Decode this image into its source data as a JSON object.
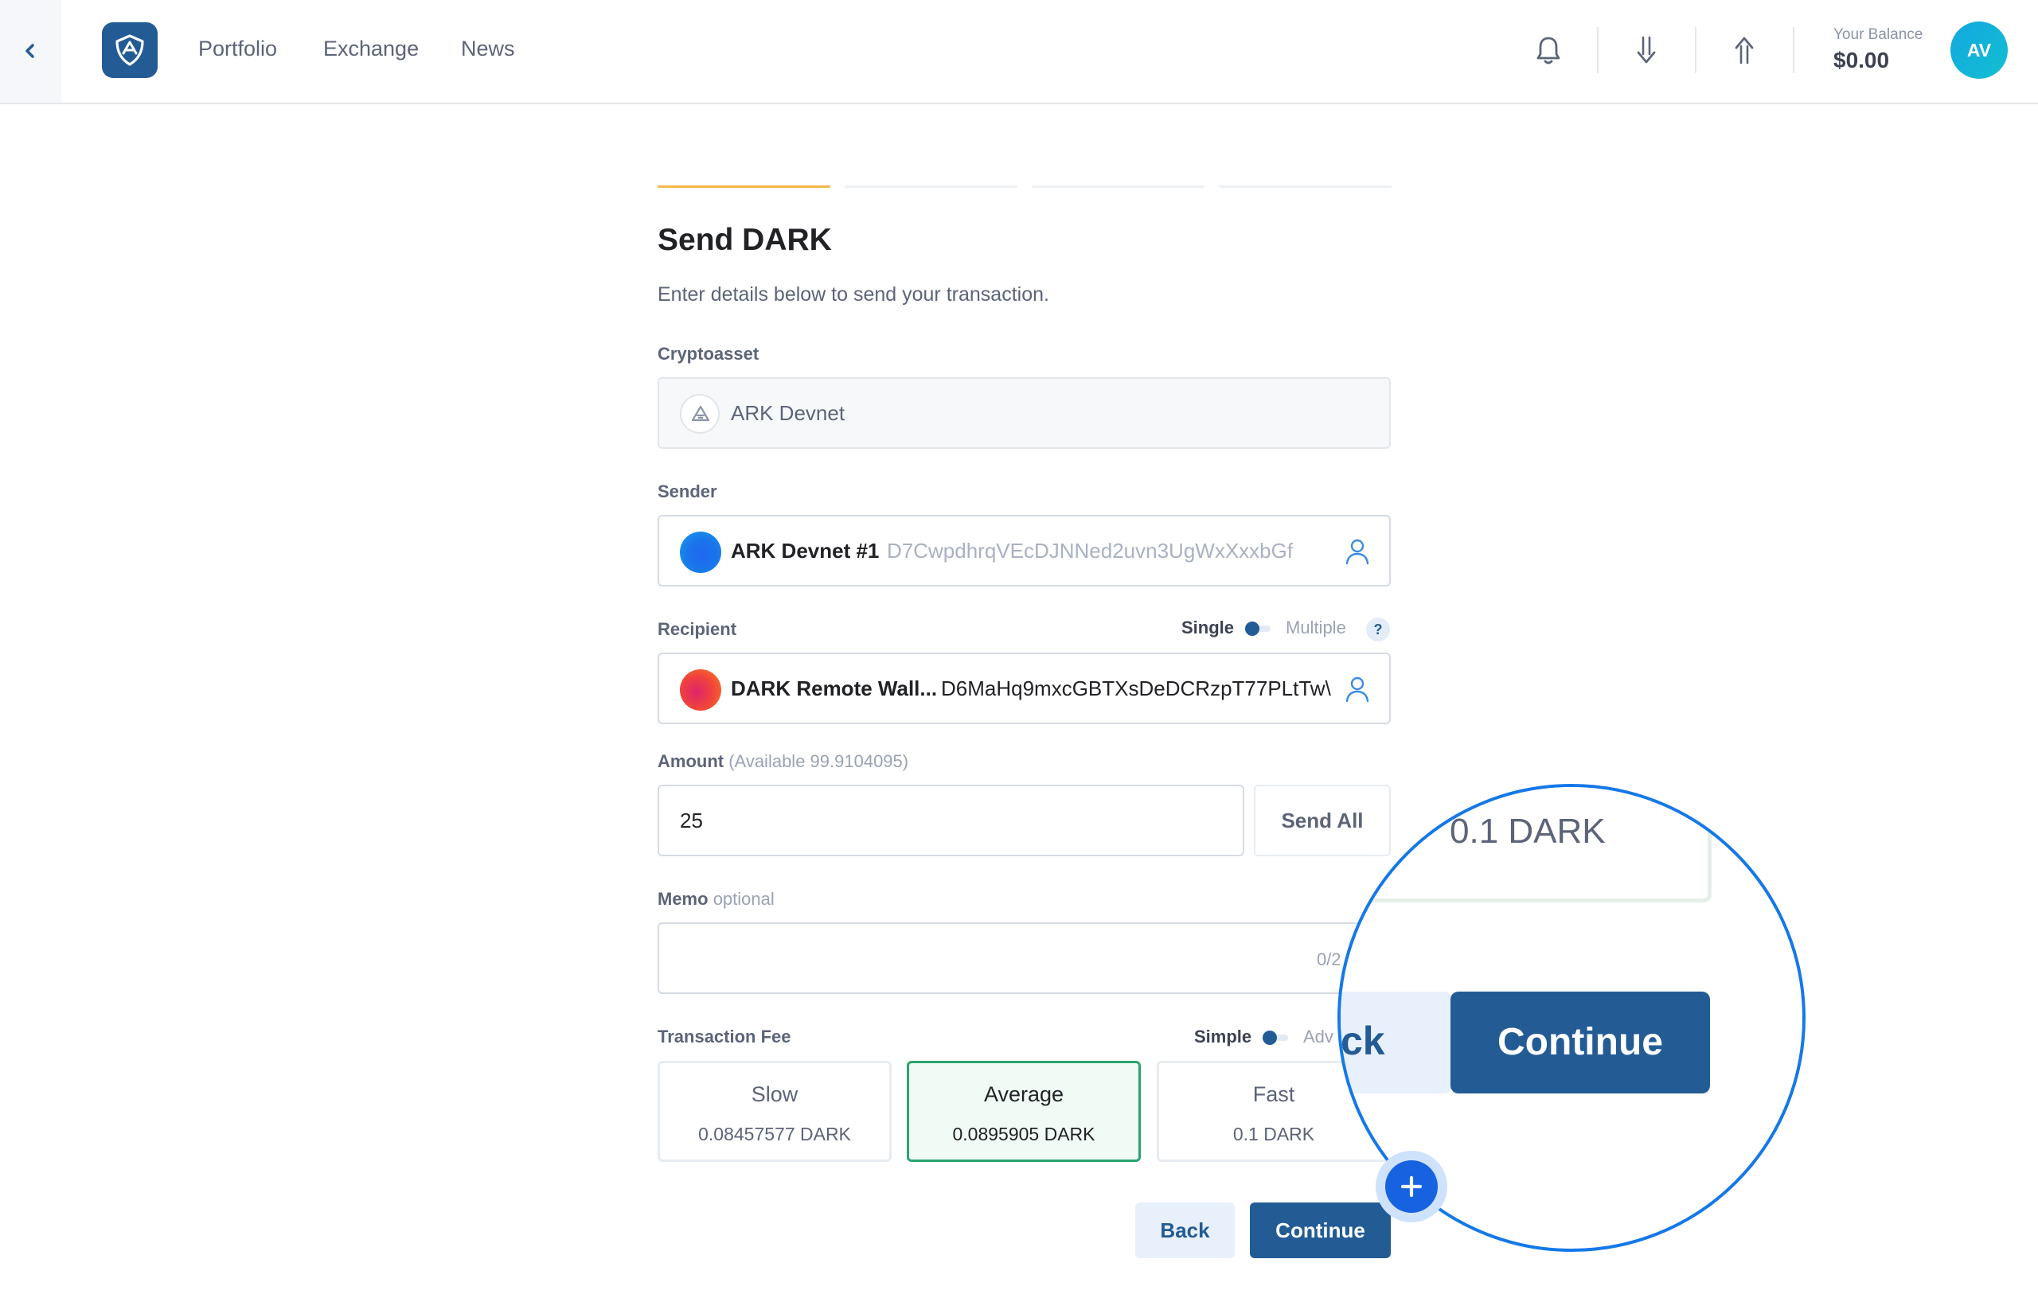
{
  "header": {
    "nav": [
      "Portfolio",
      "Exchange",
      "News"
    ],
    "balance_label": "Your Balance",
    "balance_value": "$0.00",
    "avatar_initials": "AV"
  },
  "steps": {
    "total": 4,
    "active": 1
  },
  "form": {
    "title": "Send DARK",
    "subtitle": "Enter details below to send your transaction.",
    "cryptoasset": {
      "label": "Cryptoasset",
      "value": "ARK Devnet",
      "icon": "ark-logo-icon"
    },
    "sender": {
      "label": "Sender",
      "name": "ARK Devnet #1",
      "address": "D7CwpdhrqVEcDJNNed2uvn3UgWxXxxbGf"
    },
    "recipient": {
      "label": "Recipient",
      "toggle_on": "Single",
      "toggle_off": "Multiple",
      "help": "?",
      "name": "DARK Remote Wall...",
      "address": "D6MaHq9mxcGBTXsDeDCRzpT77PLtTw\\"
    },
    "amount": {
      "label": "Amount",
      "available": "(Available 99.9104095)",
      "value": "25",
      "send_all": "Send All"
    },
    "memo": {
      "label": "Memo",
      "optional": "optional",
      "value": "",
      "count": "0/2"
    },
    "fee": {
      "label": "Transaction Fee",
      "toggle_on": "Simple",
      "toggle_off": "Adv",
      "options": [
        {
          "name": "Slow",
          "value": "0.08457577 DARK",
          "selected": false
        },
        {
          "name": "Average",
          "value": "0.0895905 DARK",
          "selected": true
        },
        {
          "name": "Fast",
          "value": "0.1 DARK",
          "selected": false
        }
      ]
    },
    "buttons": {
      "back": "Back",
      "continue": "Continue"
    }
  },
  "magnifier": {
    "fee_value": "0.1 DARK",
    "back_fragment": "ck",
    "continue": "Continue"
  },
  "colors": {
    "primary": "#235b95",
    "step_active": "#f4b84a",
    "selected_border": "#2aa36d",
    "magnifier_ring": "#1578e8"
  }
}
